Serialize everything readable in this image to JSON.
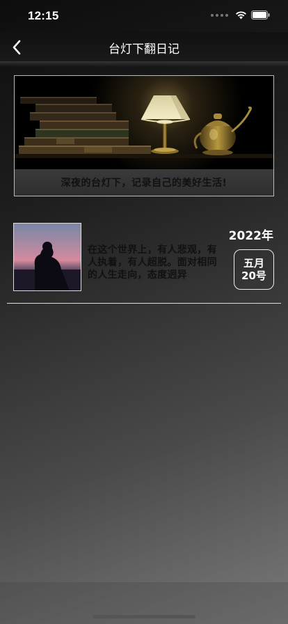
{
  "status_bar": {
    "time": "12:15",
    "wifi_icon": "wifi-icon",
    "battery_icon": "battery-icon"
  },
  "nav": {
    "back_icon": "chevron-left-icon",
    "title": "台灯下翻日记"
  },
  "banner": {
    "image": "lamp-and-books-photo",
    "caption": "深夜的台灯下，记录自己的美好生活!"
  },
  "entries": [
    {
      "thumbnail": "silhouette-at-dusk-photo",
      "excerpt": "在这个世界上，有人悲观，有人执着，有人超脱。面对相同的人生走向，态度迥异",
      "year": "2022年",
      "month": "五月",
      "day": "20号"
    }
  ],
  "colors": {
    "background_top": "#0d0d0d",
    "background_bottom": "#7a7a7a",
    "text_dark": "#111111",
    "text_light": "#ffffff"
  }
}
